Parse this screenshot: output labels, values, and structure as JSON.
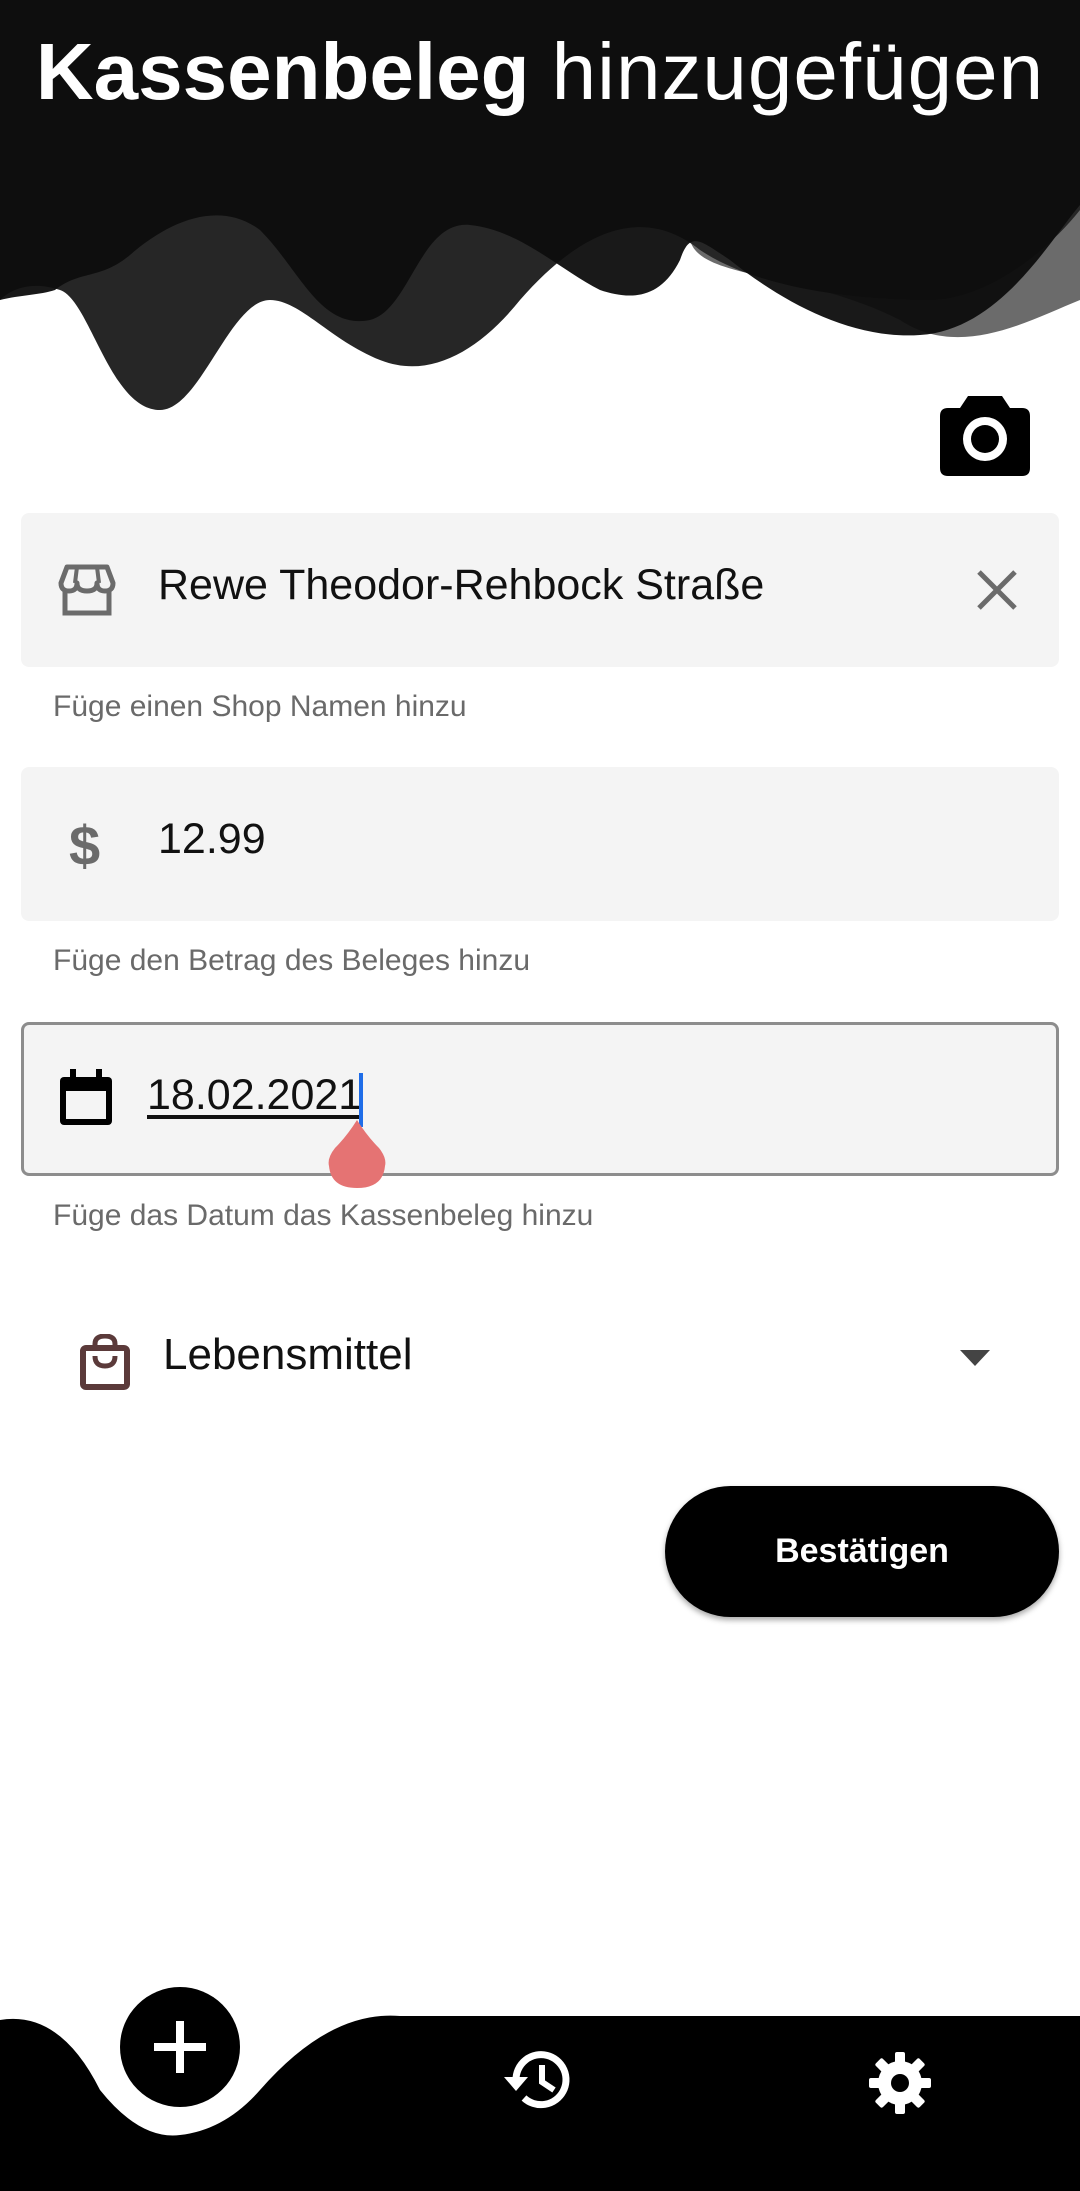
{
  "header": {
    "title_bold": "Kassenbeleg",
    "title_light": "hinzugefügen"
  },
  "camera_icon": "camera-icon",
  "fields": {
    "shop": {
      "icon": "store-icon",
      "value": "Rewe Theodor-Rehbock Straße",
      "helper": "Füge einen Shop Namen hinzu",
      "clear_icon": "close-icon"
    },
    "amount": {
      "icon": "dollar-icon",
      "value": "12.99",
      "helper": "Füge den Betrag des Beleges hinzu"
    },
    "date": {
      "icon": "calendar-icon",
      "value": "18.02.2021",
      "helper": "Füge das Datum das Kassenbeleg hinzu"
    }
  },
  "category": {
    "icon": "shopping-bag-icon",
    "selected": "Lebensmittel"
  },
  "confirm_button": "Bestätigen",
  "bottom_nav": {
    "add": "add-icon",
    "history": "history-icon",
    "settings": "settings-icon"
  },
  "colors": {
    "primary": "#000000",
    "field_bg": "#f4f4f4",
    "helper_text": "#6a6a6a",
    "cursor": "#1f6de8",
    "text_handle": "#e57373",
    "category_icon": "#5b3a3a"
  }
}
